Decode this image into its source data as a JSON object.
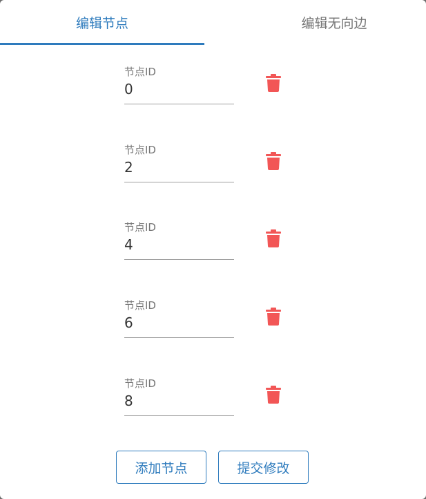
{
  "tabs": [
    {
      "label": "编辑节点",
      "active": true
    },
    {
      "label": "编辑无向边",
      "active": false
    }
  ],
  "nodes": [
    {
      "label": "节点ID",
      "value": "0"
    },
    {
      "label": "节点ID",
      "value": "2"
    },
    {
      "label": "节点ID",
      "value": "4"
    },
    {
      "label": "节点ID",
      "value": "6"
    },
    {
      "label": "节点ID",
      "value": "8"
    }
  ],
  "actions": {
    "add_label": "添加节点",
    "submit_label": "提交修改"
  },
  "colors": {
    "accent": "#2e7bbd",
    "delete": "#f25656"
  },
  "icons": {
    "delete": "trash-icon"
  }
}
